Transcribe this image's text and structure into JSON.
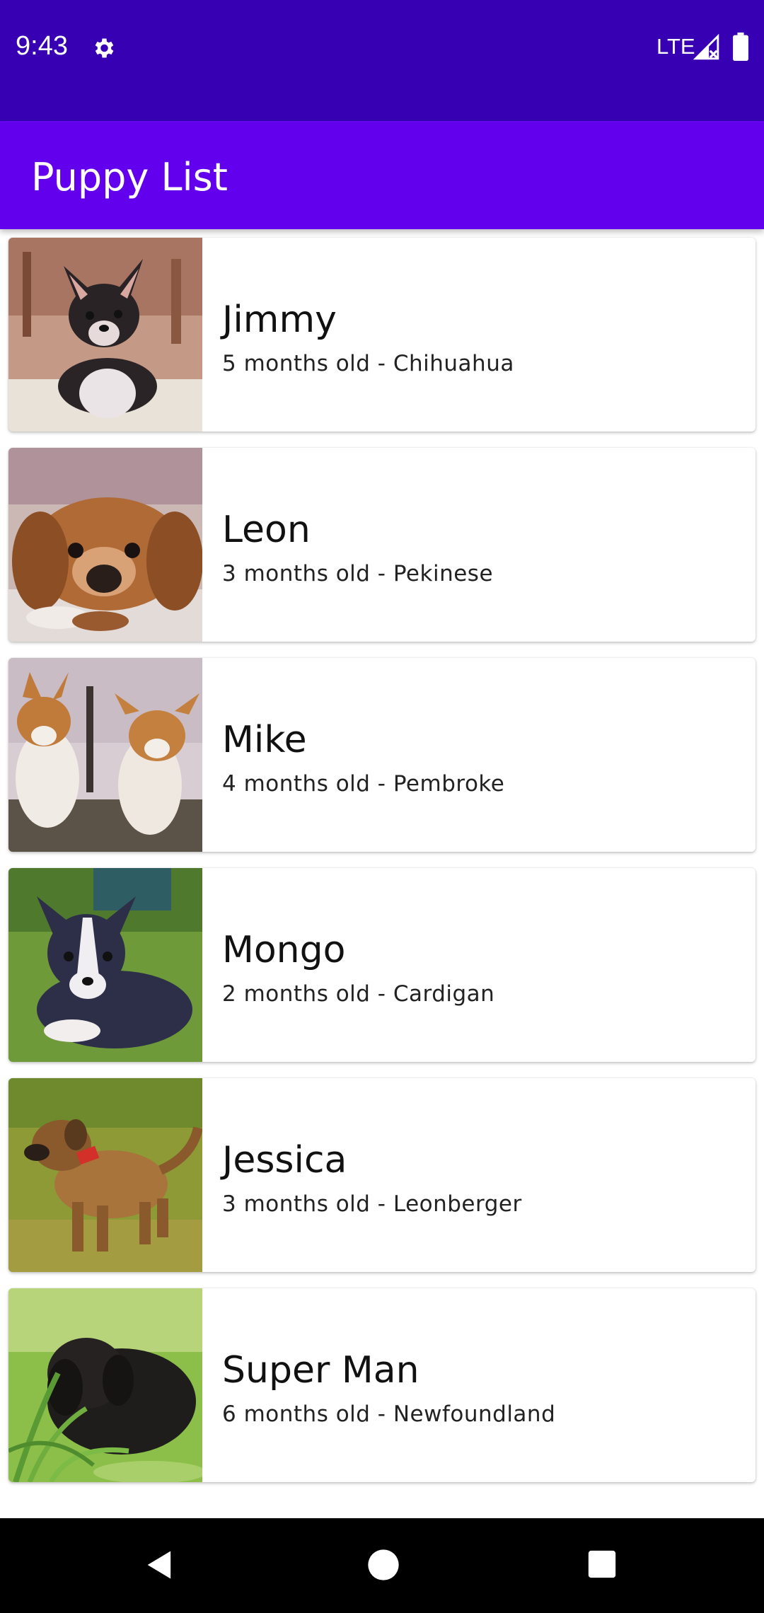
{
  "status_bar": {
    "time": "9:43",
    "network": "LTE",
    "icons": [
      "gear-icon",
      "signal-icon",
      "battery-icon"
    ],
    "background": "#3700b3"
  },
  "app_bar": {
    "title": "Puppy List",
    "background": "#6200ee"
  },
  "puppies": [
    {
      "name": "Jimmy",
      "description": "5 months old - Chihuahua"
    },
    {
      "name": "Leon",
      "description": "3 months old - Pekinese"
    },
    {
      "name": "Mike",
      "description": "4 months old - Pembroke"
    },
    {
      "name": "Mongo",
      "description": "2 months old - Cardigan"
    },
    {
      "name": "Jessica",
      "description": "3 months old - Leonberger"
    },
    {
      "name": "Super Man",
      "description": "6 months old - Newfoundland"
    }
  ],
  "nav_bar": {
    "icons": [
      "back-icon",
      "home-icon",
      "recents-icon"
    ]
  }
}
